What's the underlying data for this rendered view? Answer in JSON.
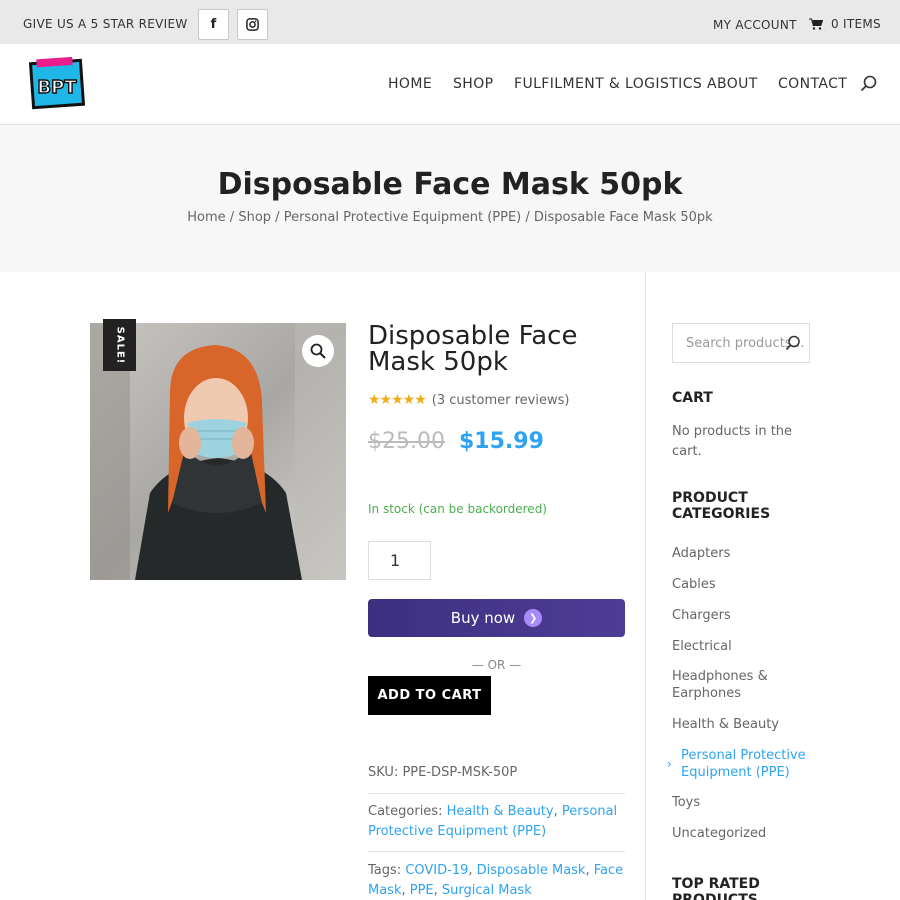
{
  "topbar": {
    "review_label": "GIVE US A 5 STAR REVIEW",
    "facebook_glyph": "f",
    "instagram_icon": "instagram-icon",
    "account_label": "MY ACCOUNT",
    "cart_label": "0 ITEMS"
  },
  "header": {
    "logo_text": "BPT",
    "nav": [
      "HOME",
      "SHOP",
      "FULFILMENT & LOGISTICS",
      "ABOUT",
      "CONTACT"
    ]
  },
  "hero": {
    "title": "Disposable Face Mask 50pk",
    "breadcrumb": [
      "Home",
      "Shop",
      "Personal Protective Equipment (PPE)",
      "Disposable Face Mask 50pk"
    ],
    "breadcrumb_sep": "/"
  },
  "product": {
    "sale_badge": "SALE!",
    "title": "Disposable Face Mask 50pk",
    "rating": 5,
    "reviews_text": "(3 customer reviews)",
    "old_price": "$25.00",
    "new_price": "$15.99",
    "stock": "In stock (can be backordered)",
    "quantity": "1",
    "buy_now_label": "Buy now",
    "or_label": "— OR —",
    "add_to_cart_label": "ADD TO CART",
    "sku_label": "SKU:",
    "sku": "PPE-DSP-MSK-50P",
    "categories_label": "Categories:",
    "categories": [
      "Health & Beauty",
      "Personal Protective Equipment (PPE)"
    ],
    "tags_label": "Tags:",
    "tags": [
      "COVID-19",
      "Disposable Mask",
      "Face Mask",
      "PPE",
      "Surgical Mask"
    ]
  },
  "sidebar": {
    "search_placeholder": "Search products…",
    "cart_heading": "CART",
    "cart_empty": "No products in the cart.",
    "categories_heading": "PRODUCT CATEGORIES",
    "categories": [
      "Adapters",
      "Cables",
      "Chargers",
      "Electrical",
      "Headphones & Earphones",
      "Health & Beauty",
      "Personal Protective Equipment (PPE)",
      "Toys",
      "Uncategorized"
    ],
    "active_category": "Personal Protective Equipment (PPE)",
    "top_rated_heading": "TOP RATED PRODUCTS"
  },
  "colors": {
    "accent": "#2ea3f2",
    "stock_green": "#4caf50",
    "star": "#f0ad1b",
    "buy_now": "#3c2f7f"
  }
}
